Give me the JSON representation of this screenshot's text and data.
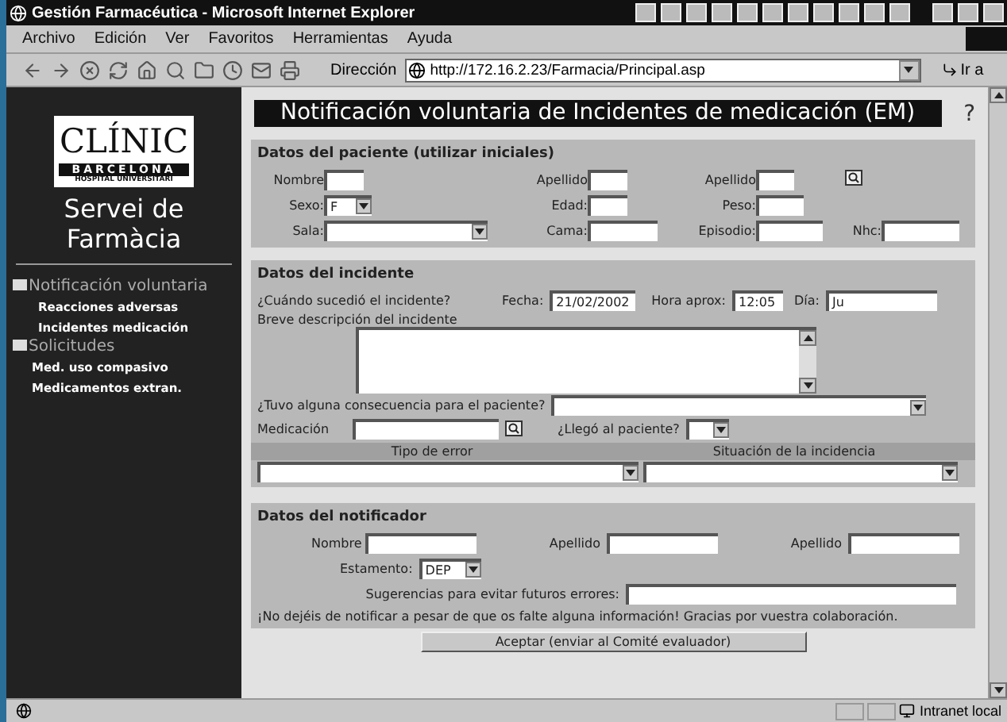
{
  "window": {
    "title": "Gestión Farmacéutica - Microsoft Internet Explorer"
  },
  "menu": [
    "Archivo",
    "Edición",
    "Ver",
    "Favoritos",
    "Herramientas",
    "Ayuda"
  ],
  "address": {
    "label": "Dirección",
    "url": "http://172.16.2.23/Farmacia/Principal.asp",
    "go": "Ir a"
  },
  "sidebar": {
    "logo": {
      "name": "CLÍNIC",
      "city": "BARCELONA",
      "subtitle": "HOSPITAL UNIVERSITARI"
    },
    "service": "Servei de Farmàcia",
    "nav": [
      {
        "label": "Notificación voluntaria",
        "children": [
          {
            "label": "Reacciones adversas"
          },
          {
            "label": "Incidentes medicación"
          }
        ]
      },
      {
        "label": "Solicitudes",
        "children": [
          {
            "label": "Med. uso compasivo"
          },
          {
            "label": "Medicamentos extran."
          }
        ]
      }
    ]
  },
  "form": {
    "title": "Notificación voluntaria de Incidentes de medicación (EM)",
    "help": "?",
    "patient": {
      "heading": "Datos del paciente (utilizar iniciales)",
      "rows": [
        [
          {
            "label": "Nombre",
            "kind": "text"
          },
          {
            "label": "Apellido",
            "kind": "text"
          },
          {
            "label": "Apellido",
            "kind": "text"
          },
          {
            "kind": "lookup"
          }
        ],
        [
          {
            "label": "Sexo:",
            "kind": "select",
            "value": "F"
          },
          {
            "label": "Edad:",
            "kind": "text"
          },
          {
            "label": "Peso:",
            "kind": "text"
          }
        ],
        [
          {
            "label": "Sala:",
            "kind": "select"
          },
          {
            "label": "Cama:",
            "kind": "text"
          },
          {
            "label": "Episodio:",
            "kind": "text"
          },
          {
            "label": "Nhc:",
            "kind": "text"
          }
        ]
      ]
    },
    "incident": {
      "heading": "Datos del incidente",
      "when": "¿Cuándo sucedió el incidente?",
      "date": {
        "label": "Fecha:",
        "value": "21/02/2002"
      },
      "time": {
        "label": "Hora aprox:",
        "value": "12:05"
      },
      "day": {
        "label": "Día:",
        "value": "Ju"
      },
      "description": "Breve descripción del incidente",
      "consequence": "¿Tuvo alguna consecuencia para el paciente?",
      "medication": "Medicación",
      "reached": "¿Llegó al paciente?",
      "columns": [
        "Tipo de error",
        "Situación de la incidencia"
      ]
    },
    "notifier": {
      "heading": "Datos del notificador",
      "fields": [
        {
          "label": "Nombre"
        },
        {
          "label": "Apellido"
        },
        {
          "label": "Apellido"
        }
      ],
      "role": {
        "label": "Estamento:",
        "value": "DEP"
      },
      "suggestions": "Sugerencias para evitar futuros errores:",
      "notice": "¡No dejéis de notificar a pesar de que os falte alguna información! Gracias por vuestra colaboración.",
      "submit": "Aceptar (enviar al Comité evaluador)"
    }
  },
  "status_bar": {
    "zone": "Intranet local"
  }
}
